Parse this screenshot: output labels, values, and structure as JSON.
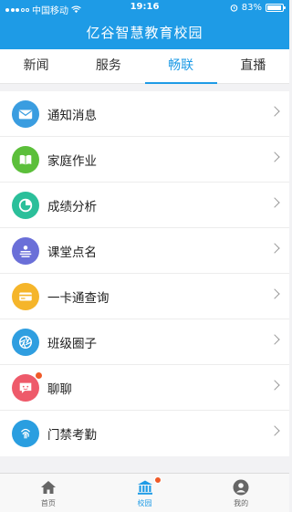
{
  "status_bar": {
    "carrier": "中国移动",
    "time": "19:16",
    "battery": "83%",
    "battery_level": 0.83
  },
  "header": {
    "title": "亿谷智慧教育校园"
  },
  "tabs": [
    {
      "label": "新闻",
      "active": false
    },
    {
      "label": "服务",
      "active": false
    },
    {
      "label": "畅联",
      "active": true
    },
    {
      "label": "直播",
      "active": false
    }
  ],
  "menu": [
    {
      "label": "通知消息",
      "icon": "notification-icon",
      "color": "#3a9de0",
      "badge": false
    },
    {
      "label": "家庭作业",
      "icon": "book-icon",
      "color": "#5bbf3a",
      "badge": false
    },
    {
      "label": "成绩分析",
      "icon": "pie-chart-icon",
      "color": "#2bbf9a",
      "badge": false
    },
    {
      "label": "课堂点名",
      "icon": "attendance-icon",
      "color": "#6a6fd8",
      "badge": false
    },
    {
      "label": "一卡通查询",
      "icon": "card-icon",
      "color": "#f5b52a",
      "badge": false
    },
    {
      "label": "班级圈子",
      "icon": "aperture-icon",
      "color": "#2f9ee0",
      "badge": false
    },
    {
      "label": "聊聊",
      "icon": "chat-icon",
      "color": "#ee5a6a",
      "badge": true
    },
    {
      "label": "门禁考勤",
      "icon": "fingerprint-icon",
      "color": "#2a9ee0",
      "badge": false
    }
  ],
  "tabbar": [
    {
      "label": "首页",
      "icon": "home-icon",
      "active": false,
      "badge": false
    },
    {
      "label": "校园",
      "icon": "campus-icon",
      "active": true,
      "badge": true
    },
    {
      "label": "我的",
      "icon": "profile-icon",
      "active": false,
      "badge": false
    }
  ]
}
